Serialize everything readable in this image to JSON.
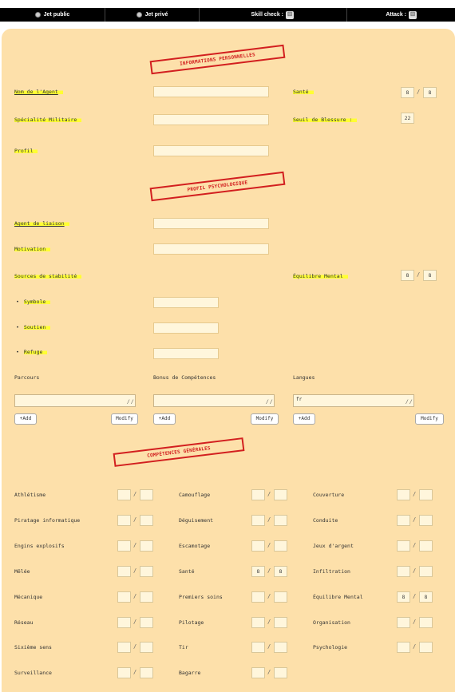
{
  "topbar": {
    "public_label": "Jet public",
    "private_label": "Jet privé",
    "skill_label": "Skill check :",
    "attack_label": "Attack :"
  },
  "sections": {
    "personal": "INFORMATIONS PERSONNELLES",
    "psych": "PROFIL PSYCHOLOGIQUE",
    "skills": "COMPÉTENCES GÉNÉRALES"
  },
  "personal": {
    "name_label": "Nom de l'Agent",
    "specialty_label": "Spécialité Militaire",
    "profile_label": "Profil",
    "health_label": "Santé",
    "health_current": "8",
    "health_max": "8",
    "wound_label": "Seuil de Blessure :",
    "wound_value": "22"
  },
  "psych": {
    "liaison_label": "Agent de liaison",
    "motivation_label": "Motivation",
    "stability_label": "Sources de stabilité",
    "symbole_label": "Symbole",
    "soutien_label": "Soutien",
    "refuge_label": "Refuge",
    "mental_label": "Équilibre Mental",
    "mental_current": "8",
    "mental_max": "8",
    "parcours_label": "Parcours",
    "bonus_label": "Bonus de Compétences",
    "langues_label": "Langues",
    "langues_value": "fr",
    "add_label": "+Add",
    "modify_label": "Modify"
  },
  "skills": {
    "col1": [
      {
        "name": "Athlétisme",
        "a": "",
        "b": ""
      },
      {
        "name": "Piratage informatique",
        "a": "",
        "b": ""
      },
      {
        "name": "Engins explosifs",
        "a": "",
        "b": ""
      },
      {
        "name": "Mêlée",
        "a": "",
        "b": ""
      },
      {
        "name": "Mécanique",
        "a": "",
        "b": ""
      },
      {
        "name": "Réseau",
        "a": "",
        "b": ""
      },
      {
        "name": "Sixième sens",
        "a": "",
        "b": ""
      },
      {
        "name": "Surveillance",
        "a": "",
        "b": ""
      }
    ],
    "col2": [
      {
        "name": "Camouflage",
        "a": "",
        "b": ""
      },
      {
        "name": "Déguisement",
        "a": "",
        "b": ""
      },
      {
        "name": "Escamotage",
        "a": "",
        "b": ""
      },
      {
        "name": "Santé",
        "a": "8",
        "b": "8"
      },
      {
        "name": "Premiers soins",
        "a": "",
        "b": ""
      },
      {
        "name": "Pilotage",
        "a": "",
        "b": ""
      },
      {
        "name": "Tir",
        "a": "",
        "b": ""
      },
      {
        "name": "Bagarre",
        "a": "",
        "b": ""
      }
    ],
    "col3": [
      {
        "name": "Couverture",
        "a": "",
        "b": ""
      },
      {
        "name": "Conduite",
        "a": "",
        "b": ""
      },
      {
        "name": "Jeux d'argent",
        "a": "",
        "b": ""
      },
      {
        "name": "Infiltration",
        "a": "",
        "b": ""
      },
      {
        "name": "Équilibre Mental",
        "a": "8",
        "b": "8"
      },
      {
        "name": "Organisation",
        "a": "",
        "b": ""
      },
      {
        "name": "Psychologie",
        "a": "",
        "b": ""
      }
    ]
  }
}
